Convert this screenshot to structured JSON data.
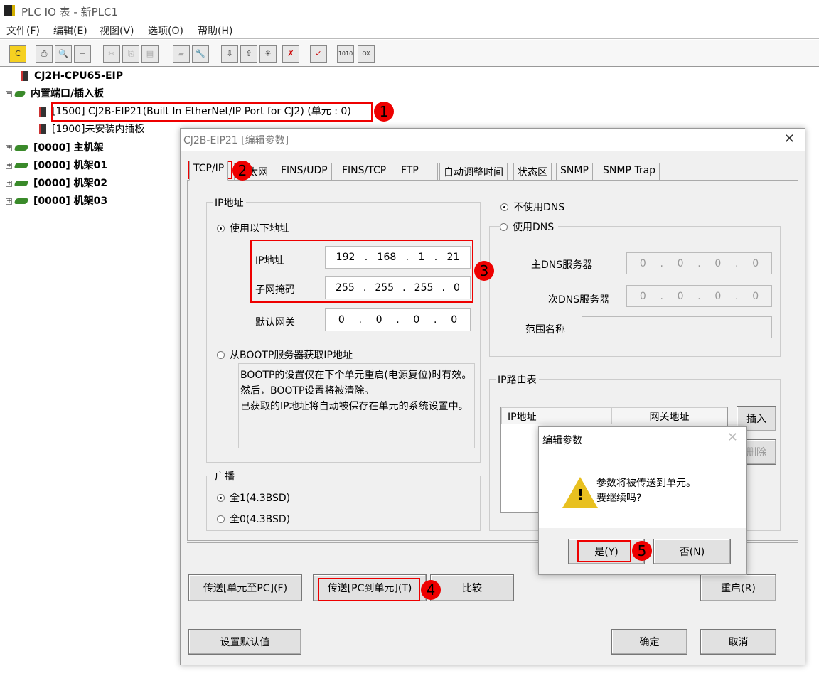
{
  "window": {
    "title": "PLC IO 表 - 新PLC1"
  },
  "menu": [
    "文件(F)",
    "编辑(E)",
    "视图(V)",
    "选项(O)",
    "帮助(H)"
  ],
  "toolbar": [
    "cps-icon",
    "print-icon",
    "print-preview-icon",
    "pin-icon",
    "cut-icon",
    "copy-icon",
    "paste-icon",
    "unit-icon",
    "wrench-icon",
    "upload-icon",
    "download-icon",
    "new-unit-icon",
    "delete-unit-icon",
    "check-icon",
    "io-transfer-icon",
    "io-compare-icon"
  ],
  "tree": {
    "cpu": "CJ2H-CPU65-EIP",
    "builtin": "内置端口/插入板",
    "eip": "[1500] CJ2B-EIP21(Built In EtherNet/IP Port for CJ2) (单元 : 0)",
    "slot": "[1900]未安装内插板",
    "racks": [
      "[0000] 主机架",
      "[0000] 机架01",
      "[0000] 机架02",
      "[0000] 机架03"
    ]
  },
  "dialog": {
    "title": "CJ2B-EIP21 [编辑参数]",
    "tabs": [
      "TCP/IP",
      "以太网",
      "FINS/UDP",
      "FINS/TCP",
      "FTP",
      "自动调整时间",
      "状态区",
      "SNMP",
      "SNMP Trap"
    ],
    "ip_group": "IP地址",
    "use_following": "使用以下地址",
    "ip_label": "IP地址",
    "ip": [
      "192",
      "168",
      "1",
      "21"
    ],
    "mask_label": "子网掩码",
    "mask": [
      "255",
      "255",
      "255",
      "0"
    ],
    "gw_label": "默认网关",
    "gw": [
      "0",
      "0",
      "0",
      "0"
    ],
    "bootp": "从BOOTP服务器获取IP地址",
    "bootp_note": [
      "BOOTP的设置仅在下个单元重启(电源复位)时有效。",
      "然后，BOOTP设置将被清除。",
      "已获取的IP地址将自动被保存在单元的系统设置中。"
    ],
    "broadcast_group": "广播",
    "bc1": "全1(4.3BSD)",
    "bc0": "全0(4.3BSD)",
    "no_dns": "不使用DNS",
    "use_dns": "使用DNS",
    "dns1_label": "主DNS服务器",
    "dns1": [
      "0",
      "0",
      "0",
      "0"
    ],
    "dns2_label": "次DNS服务器",
    "dns2": [
      "0",
      "0",
      "0",
      "0"
    ],
    "domain_label": "范围名称",
    "domain": "",
    "route_group": "IP路由表",
    "route_cols": [
      "IP地址",
      "网关地址"
    ],
    "insert": "插入",
    "delete": "删除",
    "btn_unit_to_pc": "传送[单元至PC](F)",
    "btn_pc_to_unit": "传送[PC到单元](T)",
    "btn_compare": "比较",
    "btn_restart": "重启(R)",
    "btn_default": "设置默认值",
    "btn_ok": "确定",
    "btn_cancel": "取消"
  },
  "popup": {
    "title": "编辑参数",
    "line1": "参数将被传送到单元。",
    "line2": "要继续吗?",
    "yes": "是(Y)",
    "no": "否(N)"
  },
  "badges": [
    "1",
    "2",
    "3",
    "4",
    "5"
  ],
  "colors": {
    "highlight": "#e00000"
  }
}
